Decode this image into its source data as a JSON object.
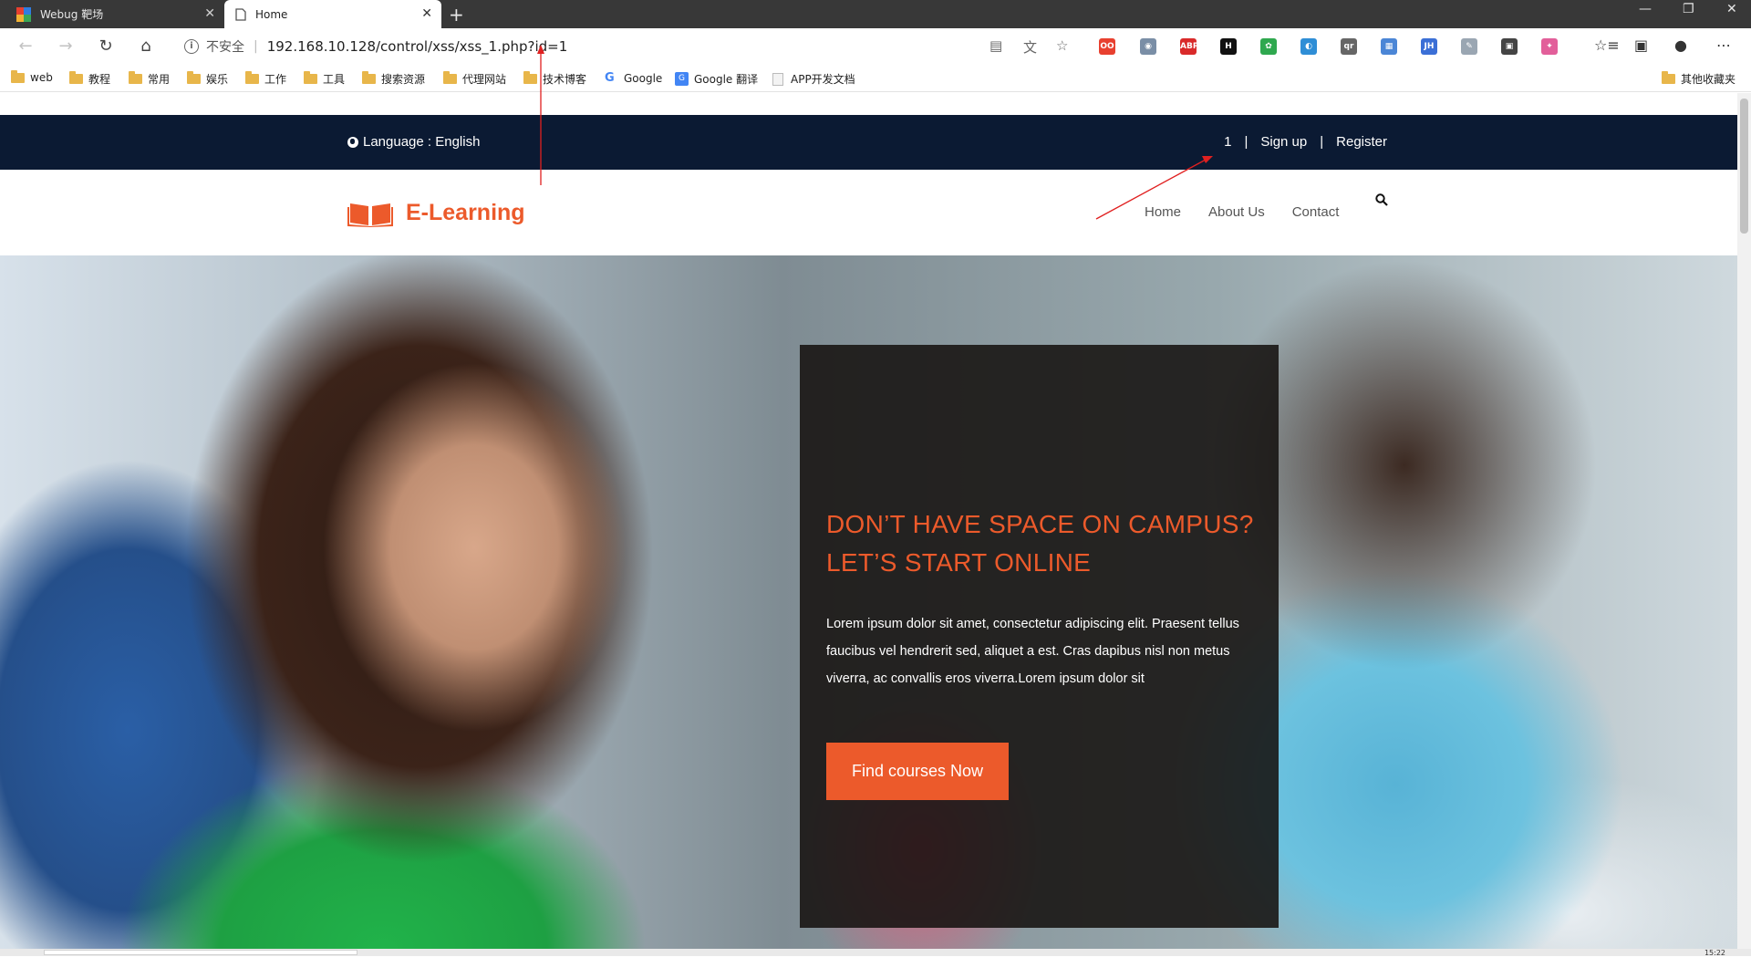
{
  "browser": {
    "tabs": [
      {
        "title": "Webug 靶场"
      },
      {
        "title": "Home"
      }
    ],
    "new_tab": "+",
    "window_controls": [
      "—",
      "❐",
      "✕"
    ],
    "address": {
      "security_label": "不安全",
      "url": "192.168.10.128/control/xss/xss_1.php?id=1"
    },
    "bookmarks": [
      {
        "label": "web",
        "icon": "folder-icon"
      },
      {
        "label": "教程",
        "icon": "folder-icon"
      },
      {
        "label": "常用",
        "icon": "folder-icon"
      },
      {
        "label": "娱乐",
        "icon": "folder-icon"
      },
      {
        "label": "工作",
        "icon": "folder-icon"
      },
      {
        "label": "工具",
        "icon": "folder-icon"
      },
      {
        "label": "搜索资源",
        "icon": "folder-icon"
      },
      {
        "label": "代理网站",
        "icon": "folder-icon"
      },
      {
        "label": "技术博客",
        "icon": "folder-icon"
      },
      {
        "label": "Google",
        "icon": "google-icon"
      },
      {
        "label": "Google 翻译",
        "icon": "google-translate-icon"
      },
      {
        "label": "APP开发文档",
        "icon": "page-icon"
      },
      {
        "label": "其他收藏夹",
        "icon": "folder-icon"
      }
    ],
    "extensions": [
      {
        "label": "OO",
        "color": "#e8402f"
      },
      {
        "label": "◉",
        "color": "#7a8ea6"
      },
      {
        "label": "ABP",
        "color": "#d92a2a"
      },
      {
        "label": "H",
        "color": "#111111"
      },
      {
        "label": "✿",
        "color": "#2fa84f"
      },
      {
        "label": "◐",
        "color": "#2f8ed6"
      },
      {
        "label": "qr",
        "color": "#666666"
      },
      {
        "label": "▦",
        "color": "#4b86d6"
      },
      {
        "label": "JH",
        "color": "#3b6fd6"
      },
      {
        "label": "✎",
        "color": "#9aa6b2"
      },
      {
        "label": "▣",
        "color": "#444444"
      },
      {
        "label": "✦",
        "color": "#e25f9a"
      }
    ]
  },
  "site": {
    "language_label": "Language : English",
    "user_value": "1",
    "signup": "Sign up",
    "register": "Register",
    "separator": "|",
    "brand": "E-Learning",
    "nav": [
      "Home",
      "About Us",
      "Contact"
    ],
    "hero": {
      "title": "DON’T HAVE SPACE ON CAMPUS? LET’S START ONLINE",
      "text": "Lorem ipsum dolor sit amet, consectetur adipiscing elit. Praesent tellus faucibus vel hendrerit sed, aliquet a est. Cras dapibus nisl non metus viverra, ac convallis eros viverra.Lorem ipsum dolor sit",
      "button": "Find courses Now"
    }
  },
  "colors": {
    "accent": "#ec5a2b",
    "topbar": "#0b1a33",
    "annotation": "#e02020"
  },
  "clock_fragment": "15:22"
}
